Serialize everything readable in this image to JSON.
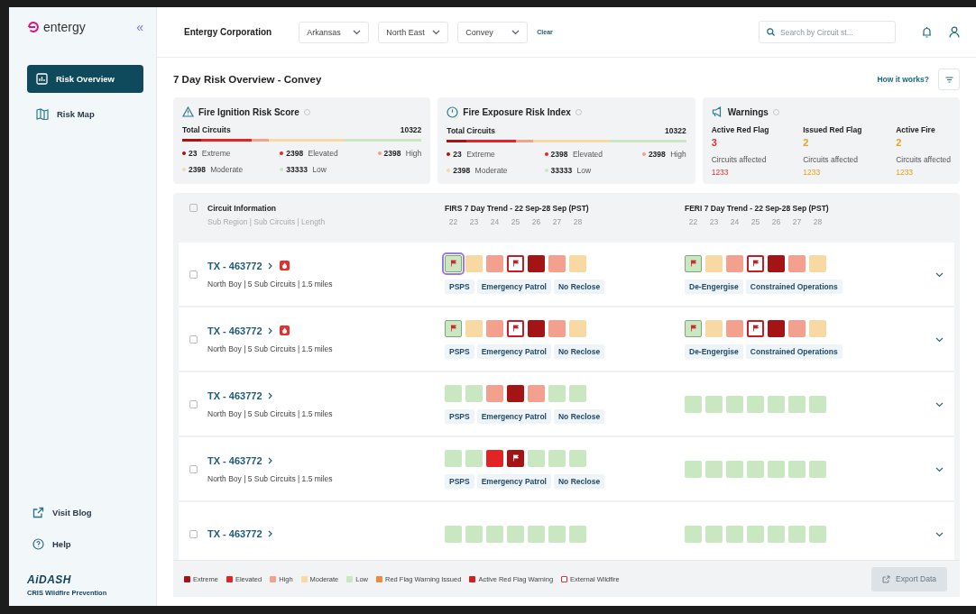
{
  "sidebar": {
    "logo": "entergy",
    "collapse": "«",
    "items": [
      {
        "label": "Risk Overview",
        "selected": true
      },
      {
        "label": "Risk Map",
        "selected": false
      }
    ],
    "footer_links": [
      "Visit Blog",
      "Help"
    ],
    "brand": "AiDASH",
    "product": "CRIS Wildfire Prevention"
  },
  "header": {
    "company": "Entergy Corporation",
    "filters": [
      "Arkansas",
      "North East",
      "Convey"
    ],
    "clear": "Clear",
    "search": {
      "placeholder": "Search by Circuit st..."
    }
  },
  "page": {
    "title": "7 Day Risk Overview - Convey",
    "help_link": "How it works?"
  },
  "cards": [
    {
      "title": "Fire Ignition Risk Score",
      "total_label": "Total Circuits",
      "total": "10322",
      "segments": [
        {
          "kind": "extreme"
        },
        {
          "kind": "elevated"
        },
        {
          "kind": "high"
        },
        {
          "kind": "moderate"
        },
        {
          "kind": "low"
        }
      ],
      "counts": [
        {
          "kind": "extreme",
          "value": "23",
          "label": "Extreme"
        },
        {
          "kind": "elevated",
          "value": "2398",
          "label": "Elevated"
        },
        {
          "kind": "high",
          "value": "2398",
          "label": "High"
        },
        {
          "kind": "moderate",
          "value": "2398",
          "label": "Moderate"
        },
        {
          "kind": "low",
          "value": "33333",
          "label": "Low"
        }
      ]
    },
    {
      "title": "Fire Exposure Risk Index",
      "total_label": "Total Circuits",
      "total": "10322",
      "segments": [
        {
          "kind": "extreme"
        },
        {
          "kind": "elevated"
        },
        {
          "kind": "high"
        },
        {
          "kind": "moderate"
        },
        {
          "kind": "low"
        }
      ],
      "counts": [
        {
          "kind": "extreme",
          "value": "23",
          "label": "Extreme"
        },
        {
          "kind": "elevated",
          "value": "2398",
          "label": "Elevated"
        },
        {
          "kind": "high",
          "value": "2398",
          "label": "High"
        },
        {
          "kind": "moderate",
          "value": "2398",
          "label": "Moderate"
        },
        {
          "kind": "low",
          "value": "33333",
          "label": "Low"
        }
      ]
    }
  ],
  "warnings": {
    "title": "Warnings",
    "items": [
      {
        "label": "Active Red Flag",
        "count": "3",
        "sub": "Circuits affected",
        "value": "1233",
        "color": "#e0303a"
      },
      {
        "label": "Issued Red Flag",
        "count": "2",
        "sub": "Circuits affected",
        "value": "1233",
        "color": "#e8a020"
      },
      {
        "label": "Active Fire",
        "count": "2",
        "sub": "Circuits affected",
        "value": "1233",
        "color": "#e8a020"
      }
    ]
  },
  "table": {
    "all_checked": false,
    "info": "Circuit Information",
    "info_sub": "Sub Region | Sub Circuits | Length",
    "trends": [
      {
        "title": "FIRS 7 Day Trend - 22 Sep-28 Sep",
        "tz": "(PST)",
        "days": [
          "22",
          "23",
          "24",
          "25",
          "26",
          "27",
          "28"
        ]
      },
      {
        "title": "FERI 7 Day Trend - 22 Sep-28 Sep",
        "tz": "(PST)",
        "days": [
          "22",
          "23",
          "24",
          "25",
          "26",
          "27",
          "28"
        ]
      }
    ],
    "rows": [
      {
        "checked": false,
        "id": "TX - 463772",
        "alert": true,
        "sub": "North Boy | 5 Sub Circuits | 1.5 miles",
        "trends": [
          {
            "cells": [
              {
                "kind": "issued",
                "focused": true
              },
              {
                "kind": "moderate",
                "focused": false
              },
              {
                "kind": "high",
                "focused": false
              },
              {
                "kind": "external",
                "focused": false
              },
              {
                "kind": "extreme",
                "focused": false
              },
              {
                "kind": "high",
                "focused": false
              },
              {
                "kind": "moderate",
                "focused": false
              }
            ],
            "tags": [
              "PSPS",
              "Emergency Patrol",
              "No Reclose"
            ]
          },
          {
            "cells": [
              {
                "kind": "issued",
                "focused": false
              },
              {
                "kind": "moderate",
                "focused": false
              },
              {
                "kind": "high",
                "focused": false
              },
              {
                "kind": "external",
                "focused": false
              },
              {
                "kind": "extreme",
                "focused": false
              },
              {
                "kind": "high",
                "focused": false
              },
              {
                "kind": "moderate",
                "focused": false
              }
            ],
            "tags": [
              "De-Engergise",
              "Constrained Operations"
            ]
          }
        ]
      },
      {
        "checked": false,
        "id": "TX - 463772",
        "alert": true,
        "sub": "North Boy | 5 Sub Circuits | 1.5 miles",
        "trends": [
          {
            "cells": [
              {
                "kind": "issued",
                "focused": false
              },
              {
                "kind": "moderate",
                "focused": false
              },
              {
                "kind": "high",
                "focused": false
              },
              {
                "kind": "external",
                "focused": false
              },
              {
                "kind": "extreme",
                "focused": false
              },
              {
                "kind": "high",
                "focused": false
              },
              {
                "kind": "moderate",
                "focused": false
              }
            ],
            "tags": [
              "PSPS",
              "Emergency Patrol",
              "No Reclose"
            ]
          },
          {
            "cells": [
              {
                "kind": "issued",
                "focused": false
              },
              {
                "kind": "moderate",
                "focused": false
              },
              {
                "kind": "high",
                "focused": false
              },
              {
                "kind": "external",
                "focused": false
              },
              {
                "kind": "extreme",
                "focused": false
              },
              {
                "kind": "high",
                "focused": false
              },
              {
                "kind": "moderate",
                "focused": false
              }
            ],
            "tags": [
              "De-Engergise",
              "Constrained Operations"
            ]
          }
        ]
      },
      {
        "checked": false,
        "id": "TX - 463772",
        "alert": false,
        "sub": "North Boy | 5 Sub Circuits | 1.5 miles",
        "trends": [
          {
            "cells": [
              {
                "kind": "low",
                "focused": false
              },
              {
                "kind": "low",
                "focused": false
              },
              {
                "kind": "high",
                "focused": false
              },
              {
                "kind": "extreme",
                "focused": false
              },
              {
                "kind": "high",
                "focused": false
              },
              {
                "kind": "low",
                "focused": false
              },
              {
                "kind": "low",
                "focused": false
              }
            ],
            "tags": [
              "PSPS",
              "Emergency Patrol",
              "No Reclose"
            ]
          },
          {
            "cells": [
              {
                "kind": "low",
                "focused": false
              },
              {
                "kind": "low",
                "focused": false
              },
              {
                "kind": "low",
                "focused": false
              },
              {
                "kind": "low",
                "focused": false
              },
              {
                "kind": "low",
                "focused": false
              },
              {
                "kind": "low",
                "focused": false
              },
              {
                "kind": "low",
                "focused": false
              }
            ]
          }
        ]
      },
      {
        "checked": false,
        "id": "TX - 463772",
        "alert": false,
        "sub": "North Boy | 5 Sub Circuits | 1.5 miles",
        "trends": [
          {
            "cells": [
              {
                "kind": "low",
                "focused": false
              },
              {
                "kind": "low",
                "focused": false
              },
              {
                "kind": "elevated",
                "focused": false
              },
              {
                "kind": "active",
                "focused": false
              },
              {
                "kind": "low",
                "focused": false
              },
              {
                "kind": "low",
                "focused": false
              },
              {
                "kind": "low",
                "focused": false
              }
            ],
            "tags": [
              "PSPS",
              "Emergency Patrol",
              "No Reclose"
            ]
          },
          {
            "cells": [
              {
                "kind": "low",
                "focused": false
              },
              {
                "kind": "low",
                "focused": false
              },
              {
                "kind": "low",
                "focused": false
              },
              {
                "kind": "low",
                "focused": false
              },
              {
                "kind": "low",
                "focused": false
              },
              {
                "kind": "low",
                "focused": false
              },
              {
                "kind": "low",
                "focused": false
              }
            ]
          }
        ]
      },
      {
        "checked": false,
        "id": "TX - 463772",
        "alert": false,
        "trends": [
          {
            "cells": [
              {
                "kind": "low",
                "focused": false
              },
              {
                "kind": "low",
                "focused": false
              },
              {
                "kind": "low",
                "focused": false
              },
              {
                "kind": "low",
                "focused": false
              },
              {
                "kind": "low",
                "focused": false
              },
              {
                "kind": "low",
                "focused": false
              },
              {
                "kind": "low",
                "focused": false
              }
            ]
          },
          {
            "cells": [
              {
                "kind": "low",
                "focused": false
              },
              {
                "kind": "low",
                "focused": false
              },
              {
                "kind": "low",
                "focused": false
              },
              {
                "kind": "low",
                "focused": false
              },
              {
                "kind": "low",
                "focused": false
              },
              {
                "kind": "low",
                "focused": false
              },
              {
                "kind": "low",
                "focused": false
              }
            ]
          }
        ]
      }
    ]
  },
  "legend": [
    {
      "kind": "extreme",
      "label": "Extreme"
    },
    {
      "kind": "elevated",
      "label": "Elevated"
    },
    {
      "kind": "high",
      "label": "High"
    },
    {
      "kind": "moderate",
      "label": "Moderate"
    },
    {
      "kind": "low",
      "label": "Low"
    },
    {
      "kind": "issued",
      "label": "Red Flag Warning Issued"
    },
    {
      "kind": "active",
      "label": "Active Red Flag Warning"
    },
    {
      "kind": "external",
      "label": "External Wildfire"
    }
  ],
  "export": {
    "label": "Export Data",
    "disabled": true
  }
}
